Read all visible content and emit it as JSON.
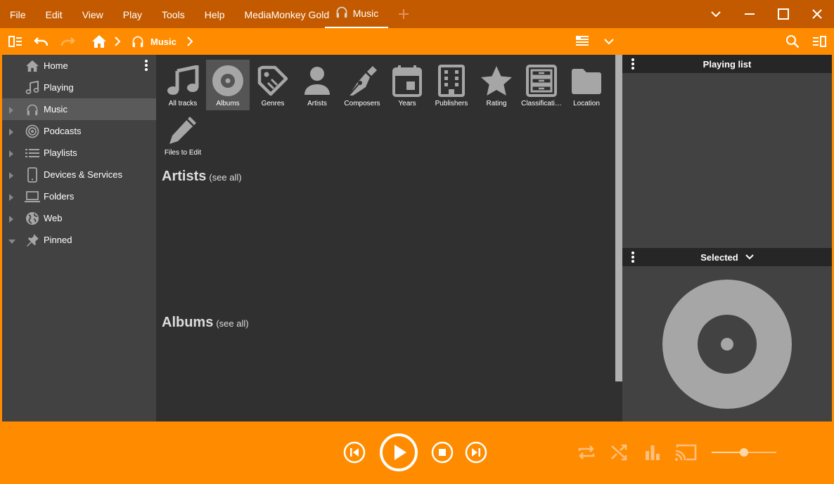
{
  "menu": {
    "items": [
      "File",
      "Edit",
      "View",
      "Play",
      "Tools",
      "Help",
      "MediaMonkey Gold"
    ]
  },
  "tab": {
    "label": "Music"
  },
  "breadcrumb": {
    "current": "Music"
  },
  "sidebar": {
    "items": [
      {
        "label": "Home",
        "icon": "home-icon"
      },
      {
        "label": "Playing",
        "icon": "music-note-icon"
      },
      {
        "label": "Music",
        "icon": "headphones-icon"
      },
      {
        "label": "Podcasts",
        "icon": "podcast-icon"
      },
      {
        "label": "Playlists",
        "icon": "playlist-icon"
      },
      {
        "label": "Devices & Services",
        "icon": "phone-icon"
      },
      {
        "label": "Folders",
        "icon": "laptop-icon"
      },
      {
        "label": "Web",
        "icon": "globe-icon"
      },
      {
        "label": "Pinned",
        "icon": "pin-icon"
      }
    ]
  },
  "categories": [
    {
      "label": "All tracks",
      "icon": "music-note-icon"
    },
    {
      "label": "Albums",
      "icon": "disc-icon"
    },
    {
      "label": "Genres",
      "icon": "tag-icon"
    },
    {
      "label": "Artists",
      "icon": "person-icon"
    },
    {
      "label": "Composers",
      "icon": "pen-nib-icon"
    },
    {
      "label": "Years",
      "icon": "calendar-icon"
    },
    {
      "label": "Publishers",
      "icon": "building-icon"
    },
    {
      "label": "Rating",
      "icon": "star-icon"
    },
    {
      "label": "Classificati…",
      "icon": "cabinet-icon"
    },
    {
      "label": "Location",
      "icon": "folder-icon"
    },
    {
      "label": "Files to Edit",
      "icon": "pencil-icon"
    }
  ],
  "sections": {
    "artists": {
      "title": "Artists",
      "see_all": "(see all)"
    },
    "albums": {
      "title": "Albums",
      "see_all": "(see all)"
    }
  },
  "right": {
    "playing_list": "Playing list",
    "selected": "Selected"
  },
  "player": {
    "volume": 0.5
  },
  "colors": {
    "accent": "#ff8c00",
    "titlebar": "#c45a00",
    "icon_gray": "#a6a6a6"
  }
}
